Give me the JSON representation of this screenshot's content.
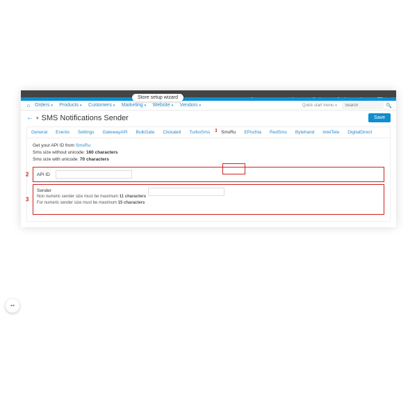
{
  "pill": "Store setup wizard",
  "topmenu": {
    "addons": "Add-ons",
    "admin": "Administration",
    "settings": "Settings",
    "design": "Design",
    "lang": "EN"
  },
  "navmenu": {
    "orders": "Orders",
    "products": "Products",
    "customers": "Customers",
    "marketing": "Marketing",
    "website": "Website",
    "vendors": "Vendors",
    "qsm": "Quick start menu",
    "search_ph": "Search"
  },
  "header": {
    "title": "SMS Notifications Sender",
    "save": "Save"
  },
  "tabs": [
    "General",
    "Events",
    "Settings",
    "GatewayAPI",
    "BulkGate",
    "Clickatell",
    "TurboSms",
    "SmsRu",
    "EPochta",
    "RedSms",
    "Bytehand",
    "intelTele",
    "DigitalDirect"
  ],
  "info": {
    "l1a": "Get your API ID from ",
    "l1b": "SmsRu",
    "l2a": "Sms size without unicode: ",
    "l2b": "160 characters",
    "l3a": "Sms size with unicode: ",
    "l3b": "70 characters"
  },
  "row2": {
    "label": "API ID"
  },
  "row3": {
    "label": "Sender",
    "s1a": "Non numeric sender size must be maximum ",
    "s1b": "11 characters",
    "s2a": "For numeric sender size must be maximum ",
    "s2b": "15 characters"
  },
  "nums": {
    "n1": "1",
    "n2": "2",
    "n3": "3"
  }
}
